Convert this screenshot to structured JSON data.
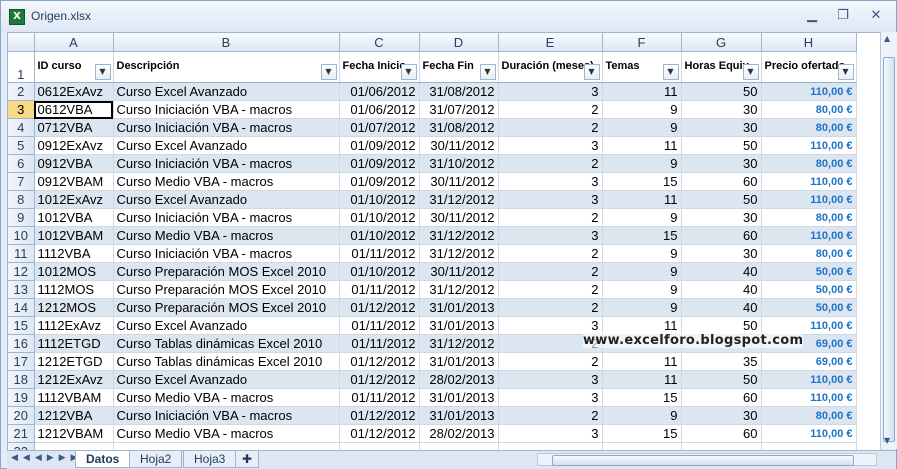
{
  "window": {
    "title": "Origen.xlsx",
    "icon": "excel-file-icon"
  },
  "columns": [
    "A",
    "B",
    "C",
    "D",
    "E",
    "F",
    "G",
    "H"
  ],
  "headers": [
    "ID curso",
    "Descripción",
    "Fecha Inicio",
    "Fecha Fin",
    "Duración (meses)",
    "Temas",
    "Horas Equiv",
    "Precio ofertado"
  ],
  "rows": [
    [
      "0612ExAvz",
      "Curso Excel Avanzado",
      "01/06/2012",
      "31/08/2012",
      "3",
      "11",
      "50",
      "110,00 €"
    ],
    [
      "0612VBA",
      "Curso Iniciación VBA - macros",
      "01/06/2012",
      "31/07/2012",
      "2",
      "9",
      "30",
      "80,00 €"
    ],
    [
      "0712VBA",
      "Curso Iniciación VBA - macros",
      "01/07/2012",
      "31/08/2012",
      "2",
      "9",
      "30",
      "80,00 €"
    ],
    [
      "0912ExAvz",
      "Curso Excel Avanzado",
      "01/09/2012",
      "30/11/2012",
      "3",
      "11",
      "50",
      "110,00 €"
    ],
    [
      "0912VBA",
      "Curso Iniciación VBA - macros",
      "01/09/2012",
      "31/10/2012",
      "2",
      "9",
      "30",
      "80,00 €"
    ],
    [
      "0912VBAM",
      "Curso Medio VBA - macros",
      "01/09/2012",
      "30/11/2012",
      "3",
      "15",
      "60",
      "110,00 €"
    ],
    [
      "1012ExAvz",
      "Curso Excel Avanzado",
      "01/10/2012",
      "31/12/2012",
      "3",
      "11",
      "50",
      "110,00 €"
    ],
    [
      "1012VBA",
      "Curso Iniciación VBA - macros",
      "01/10/2012",
      "30/11/2012",
      "2",
      "9",
      "30",
      "80,00 €"
    ],
    [
      "1012VBAM",
      "Curso Medio VBA - macros",
      "01/10/2012",
      "31/12/2012",
      "3",
      "15",
      "60",
      "110,00 €"
    ],
    [
      "1112VBA",
      "Curso Iniciación VBA - macros",
      "01/11/2012",
      "31/12/2012",
      "2",
      "9",
      "30",
      "80,00 €"
    ],
    [
      "1012MOS",
      "Curso Preparación MOS Excel 2010",
      "01/10/2012",
      "30/11/2012",
      "2",
      "9",
      "40",
      "50,00 €"
    ],
    [
      "1112MOS",
      "Curso Preparación MOS Excel 2010",
      "01/11/2012",
      "31/12/2012",
      "2",
      "9",
      "40",
      "50,00 €"
    ],
    [
      "1212MOS",
      "Curso Preparación MOS Excel 2010",
      "01/12/2012",
      "31/01/2013",
      "2",
      "9",
      "40",
      "50,00 €"
    ],
    [
      "1112ExAvz",
      "Curso Excel Avanzado",
      "01/11/2012",
      "31/01/2013",
      "3",
      "11",
      "50",
      "110,00 €"
    ],
    [
      "1112ETGD",
      "Curso Tablas dinámicas Excel 2010",
      "01/11/2012",
      "31/12/2012",
      "2",
      "",
      "",
      "69,00 €"
    ],
    [
      "1212ETGD",
      "Curso Tablas dinámicas Excel 2010",
      "01/12/2012",
      "31/01/2013",
      "2",
      "11",
      "35",
      "69,00 €"
    ],
    [
      "1212ExAvz",
      "Curso Excel Avanzado",
      "01/12/2012",
      "28/02/2013",
      "3",
      "11",
      "50",
      "110,00 €"
    ],
    [
      "1112VBAM",
      "Curso Medio VBA - macros",
      "01/11/2012",
      "31/01/2013",
      "3",
      "15",
      "60",
      "110,00 €"
    ],
    [
      "1212VBA",
      "Curso Iniciación VBA - macros",
      "01/12/2012",
      "31/01/2013",
      "2",
      "9",
      "30",
      "80,00 €"
    ],
    [
      "1212VBAM",
      "Curso Medio VBA - macros",
      "01/12/2012",
      "28/02/2013",
      "3",
      "15",
      "60",
      "110,00 €"
    ]
  ],
  "selected_row": 3,
  "watermark": "www.excelforo.blogspot.com",
  "sheets": [
    "Datos",
    "Hoja2",
    "Hoja3"
  ],
  "active_sheet": "Datos",
  "colors": {
    "price": "#1f73c7",
    "band": "#dce6f1",
    "selected_row_header": "#f8d988"
  }
}
